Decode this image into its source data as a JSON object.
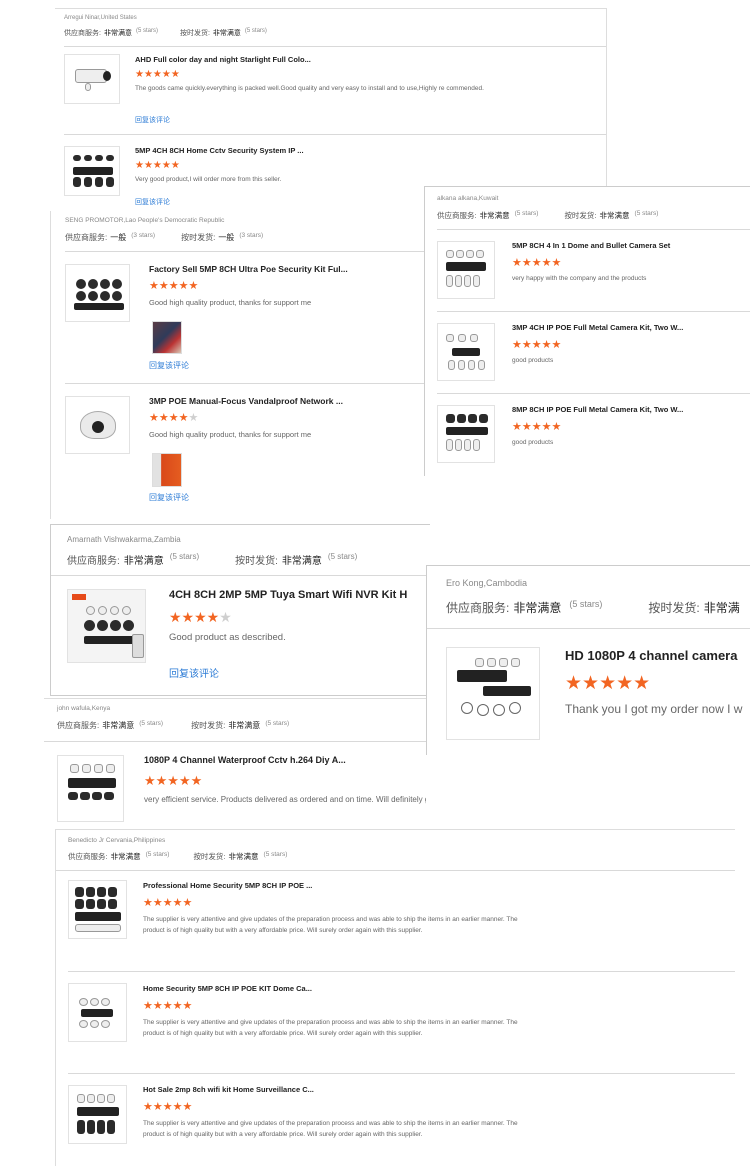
{
  "labels": {
    "service": "供应商服务:",
    "shipping": "按时发货:",
    "reply": "回复该评论",
    "very_satisfied": "非常满意",
    "general": "一般"
  },
  "colors": {
    "star": "#f26522",
    "link": "#2d7cd6",
    "divider": "#d9d9d9"
  },
  "reviews": [
    {
      "reviewer": "Arregui Ninar,United States",
      "service": {
        "value": "非常满意",
        "stars": "(5 stars)"
      },
      "shipping": {
        "value": "非常满意",
        "stars": "(5 stars)"
      },
      "items": [
        {
          "title": "AHD Full color day and night Starlight Full Colo...",
          "rating": 5,
          "comment": "The goods came quickly.everything is packed well.Good quality and very easy to install and to use,Highly re commended.",
          "reply": "回复该评论",
          "thumb_icon": "bullet-camera-icon"
        },
        {
          "title": "5MP 4CH 8CH Home Cctv Security System IP ...",
          "rating": 5,
          "comment": "Very good product,I will order more from this seller.",
          "reply": "回复该评论",
          "thumb_icon": "camera-kit-icon"
        }
      ]
    },
    {
      "reviewer": "SENG PROMOTOR,Lao People's Democratic Republic",
      "service": {
        "value": "一般",
        "stars": "(3 stars)"
      },
      "shipping": {
        "value": "一般",
        "stars": "(3 stars)"
      },
      "items": [
        {
          "title": "Factory Sell 5MP 8CH Ultra Poe Security Kit Ful...",
          "rating": 5,
          "comment": "Good high quality product, thanks for support me",
          "reply": "回复该评论",
          "thumb_icon": "camera-kit-icon"
        },
        {
          "title": "3MP POE Manual-Focus Vandalproof Network ...",
          "rating": 4,
          "comment": "Good high quality product, thanks for support me",
          "reply": "回复该评论",
          "thumb_icon": "dome-camera-icon"
        }
      ]
    },
    {
      "reviewer": "alkana alkana,Kuwait",
      "service": {
        "value": "非常满意",
        "stars": "(5 stars)"
      },
      "shipping": {
        "value": "非常满意",
        "stars": "(5 stars)"
      },
      "items": [
        {
          "title": "5MP 8CH 4 In 1 Dome and Bullet Camera Set",
          "rating": 5,
          "comment": "very happy with the company and the products",
          "thumb_icon": "camera-kit-icon"
        },
        {
          "title": "3MP 4CH IP POE Full Metal Camera Kit, Two W...",
          "rating": 5,
          "comment": "good products",
          "thumb_icon": "camera-kit-icon"
        },
        {
          "title": "8MP 8CH IP POE Full Metal Camera Kit, Two W...",
          "rating": 5,
          "comment": "good products",
          "thumb_icon": "camera-kit-icon"
        }
      ]
    },
    {
      "reviewer": "Amarnath Vishwakarma,Zambia",
      "service": {
        "value": "非常满意",
        "stars": "(5 stars)"
      },
      "shipping": {
        "value": "非常满意",
        "stars": "(5 stars)"
      },
      "items": [
        {
          "title": "4CH 8CH 2MP 5MP Tuya Smart Wifi NVR Kit H",
          "rating": 4,
          "comment": "Good product as described.",
          "reply": "回复该评论",
          "thumb_icon": "wifi-camera-kit-icon"
        }
      ]
    },
    {
      "reviewer": "Ero Kong,Cambodia",
      "service": {
        "value": "非常满意",
        "stars": "(5 stars)"
      },
      "shipping": {
        "value": "非常满",
        "stars": ""
      },
      "items": [
        {
          "title": "HD 1080P 4 channel camera",
          "rating": 5,
          "comment": "Thank you I got my order now I w",
          "thumb_icon": "camera-kit-icon"
        }
      ]
    },
    {
      "reviewer": "john wafula,Kenya",
      "service": {
        "value": "非常满意",
        "stars": "(5 stars)"
      },
      "shipping": {
        "value": "非常满意",
        "stars": "(5 stars)"
      },
      "items": [
        {
          "title": "1080P 4 Channel Waterproof Cctv h.264 Diy A...",
          "rating": 5,
          "comment": "very efficient service. Products delivered as ordered and on time. Will definitely give repeat order",
          "thumb_icon": "camera-kit-icon"
        }
      ]
    },
    {
      "reviewer": "Benedicto Jr Cervania,Philippines",
      "service": {
        "value": "非常满意",
        "stars": "(5 stars)"
      },
      "shipping": {
        "value": "非常满意",
        "stars": "(5 stars)"
      },
      "items": [
        {
          "title": "Professional Home Security 5MP 8CH IP POE ...",
          "rating": 5,
          "comment": "The supplier is very attentive and give updates of the preparation process and was able to ship the items in an earlier manner. The product is of high quality but with a very affordable price. Will surely order again with this supplier.",
          "thumb_icon": "camera-kit-icon"
        },
        {
          "title": "Home Security 5MP 8CH IP POE KIT Dome Ca...",
          "rating": 5,
          "comment": "The supplier is very attentive and give updates of the preparation process and was able to ship the items in an earlier manner. The product is of high quality but with a very affordable price. Will surely order again with this supplier.",
          "thumb_icon": "dome-camera-kit-icon"
        },
        {
          "title": "Hot Sale 2mp 8ch wifi kit Home Surveillance C...",
          "rating": 5,
          "comment": "The supplier is very attentive and give updates of the preparation process and was able to ship the items in an earlier manner. The product is of high quality but with a very affordable price. Will surely order again with this supplier.",
          "thumb_icon": "wifi-camera-kit-icon"
        }
      ]
    }
  ]
}
